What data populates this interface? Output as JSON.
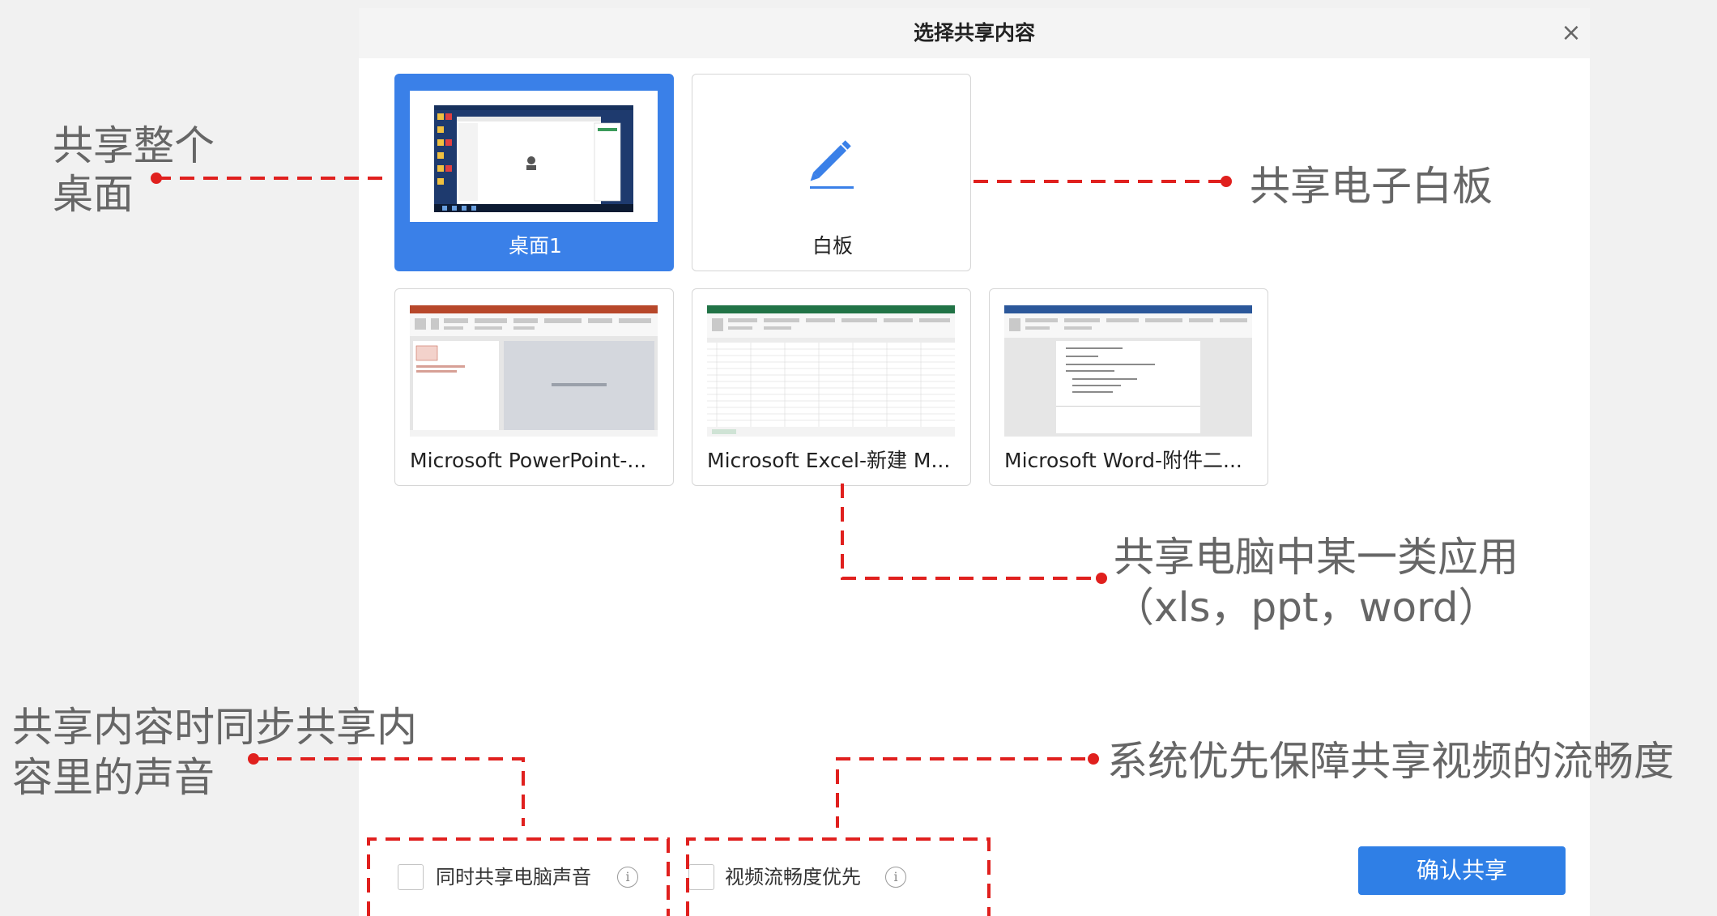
{
  "dialog": {
    "title": "选择共享内容",
    "close_glyph": "×",
    "cards": [
      {
        "label": "桌面1",
        "type": "desktop",
        "selected": true
      },
      {
        "label": "白板",
        "type": "whiteboard",
        "selected": false
      },
      {
        "label": "Microsoft PowerPoint-...",
        "type": "powerpoint",
        "selected": false
      },
      {
        "label": "Microsoft Excel-新建 M...",
        "type": "excel",
        "selected": false
      },
      {
        "label": "Microsoft Word-附件二...",
        "type": "word",
        "selected": false
      }
    ],
    "options": [
      {
        "label": "同时共享电脑声音",
        "checked": false
      },
      {
        "label": "视频流畅度优先",
        "checked": false
      }
    ],
    "confirm_label": "确认共享"
  },
  "annotations": {
    "desktop_line1": "共享整个",
    "desktop_line2": "桌面",
    "whiteboard": "共享电子白板",
    "apps_line1": "共享电脑中某一类应用",
    "apps_line2": "（xls，ppt，word）",
    "audio_line1": "共享内容时同步共享内",
    "audio_line2": "容里的声音",
    "smooth": "系统优先保障共享视频的流畅度"
  },
  "icons": {
    "whiteboard": "pencil-icon",
    "info": "info-icon",
    "close": "close-icon"
  },
  "colors": {
    "accent": "#3a80e8",
    "button": "#2f7fe6",
    "annotation_line": "#e0201e",
    "annotation_text": "#666666",
    "excel_green": "#217346",
    "powerpoint_red": "#b7472a",
    "word_blue": "#2b579a"
  }
}
